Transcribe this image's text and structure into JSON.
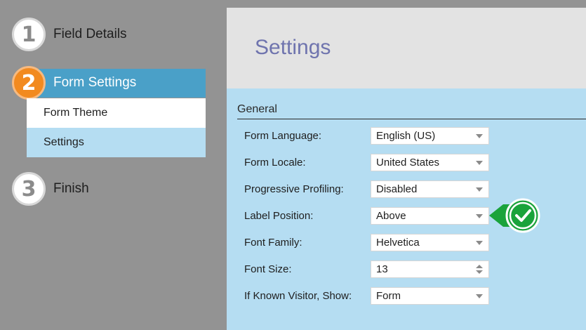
{
  "steps": [
    {
      "number": "1",
      "label": "Field Details"
    },
    {
      "number": "2",
      "label": "Form Settings",
      "substeps": [
        "Form Theme",
        "Settings"
      ]
    },
    {
      "number": "3",
      "label": "Finish"
    }
  ],
  "main": {
    "title": "Settings",
    "section": "General",
    "rows": [
      {
        "label": "Form Language:",
        "value": "English (US)"
      },
      {
        "label": "Form Locale:",
        "value": "United States"
      },
      {
        "label": "Progressive Profiling:",
        "value": "Disabled"
      },
      {
        "label": "Label Position:",
        "value": "Above"
      },
      {
        "label": "Font Family:",
        "value": "Helvetica"
      },
      {
        "label": "Font Size:",
        "value": "13"
      },
      {
        "label": "If Known Visitor, Show:",
        "value": "Form"
      }
    ]
  },
  "colors": {
    "active_step": "#f28a1f",
    "active_bar": "#4aa0c8",
    "panel": "#b5ddf2",
    "title": "#6f74ae",
    "callout": "#1aa33b"
  },
  "icons": {
    "callout": "checkmark-callout-icon",
    "select": "caret-down-icon",
    "spinner": "spinner-icon"
  }
}
